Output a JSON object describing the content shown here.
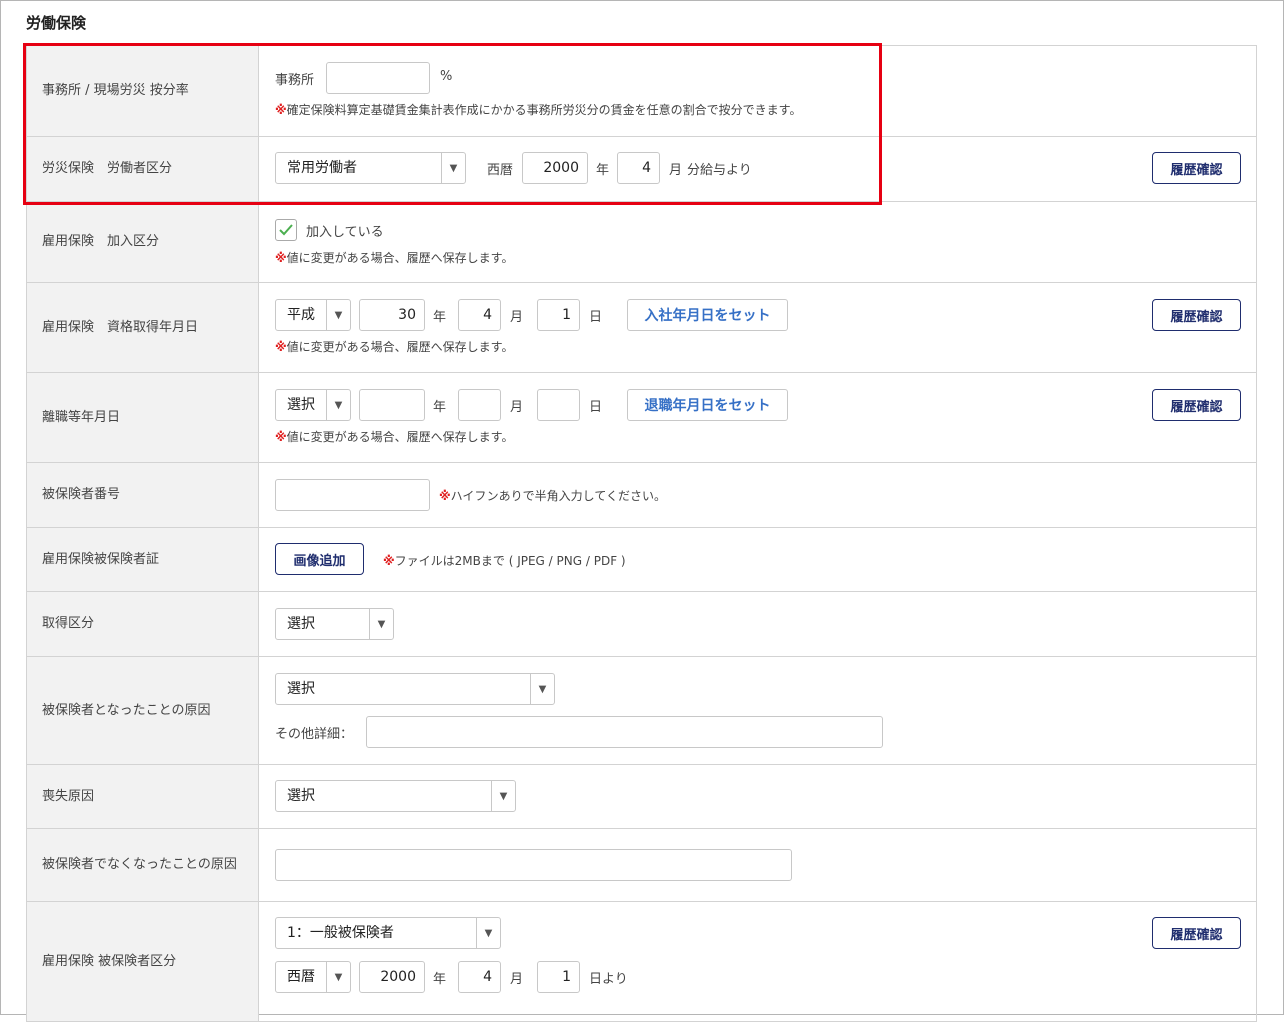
{
  "section_title": "労働保険",
  "rows": {
    "office_ratio": {
      "label": "事務所 / 現場労災 按分率",
      "prefix": "事務所",
      "value": "",
      "unit": "%",
      "note_mark": "※",
      "note": "確定保険料算定基礎賃金集計表作成にかかる事務所労災分の賃金を任意の割合で按分できます。"
    },
    "worker_class": {
      "label": "労災保険　労働者区分",
      "select_value": "常用労働者",
      "era_label": "西暦",
      "year": "2000",
      "year_unit": "年",
      "month": "4",
      "month_unit": "月",
      "suffix": "分給与より",
      "history_button": "履歴確認"
    },
    "employment_join": {
      "label": "雇用保険　加入区分",
      "checkbox_label": "加入している",
      "note_mark": "※",
      "note": "値に変更がある場合、履歴へ保存します。"
    },
    "acquisition_date": {
      "label": "雇用保険　資格取得年月日",
      "era": "平成",
      "year": "30",
      "year_unit": "年",
      "month": "4",
      "month_unit": "月",
      "day": "1",
      "day_unit": "日",
      "set_button": "入社年月日をセット",
      "history_button": "履歴確認",
      "note_mark": "※",
      "note": "値に変更がある場合、履歴へ保存します。"
    },
    "leave_date": {
      "label": "離職等年月日",
      "era": "選択",
      "year": "",
      "year_unit": "年",
      "month": "",
      "month_unit": "月",
      "day": "",
      "day_unit": "日",
      "set_button": "退職年月日をセット",
      "history_button": "履歴確認",
      "note_mark": "※",
      "note": "値に変更がある場合、履歴へ保存します。"
    },
    "insured_number": {
      "label": "被保険者番号",
      "value": "",
      "note_mark": "※",
      "note": "ハイフンありで半角入力してください。"
    },
    "insured_card": {
      "label": "雇用保険被保険者証",
      "button": "画像追加",
      "note_mark": "※",
      "note": "ファイルは2MBまで ( JPEG / PNG / PDF )"
    },
    "acquisition_class": {
      "label": "取得区分",
      "select_value": "選択"
    },
    "insured_cause": {
      "label": "被保険者となったことの原因",
      "select_value": "選択",
      "other_label": "その他詳細：",
      "other_value": ""
    },
    "loss_cause": {
      "label": "喪失原因",
      "select_value": "選択"
    },
    "lost_cause": {
      "label": "被保険者でなくなったことの原因",
      "value": ""
    },
    "insured_class": {
      "label": "雇用保険 被保険者区分",
      "select_value": "1：一般被保険者",
      "era": "西暦",
      "year": "2000",
      "year_unit": "年",
      "month": "4",
      "month_unit": "月",
      "day": "1",
      "suffix": "日より",
      "history_button": "履歴確認"
    }
  },
  "colors": {
    "highlight": "#e60012",
    "note_mark": "#e02020",
    "nav_button": "#1f2d6e",
    "link_button": "#3670c6",
    "check": "#4caf50"
  }
}
